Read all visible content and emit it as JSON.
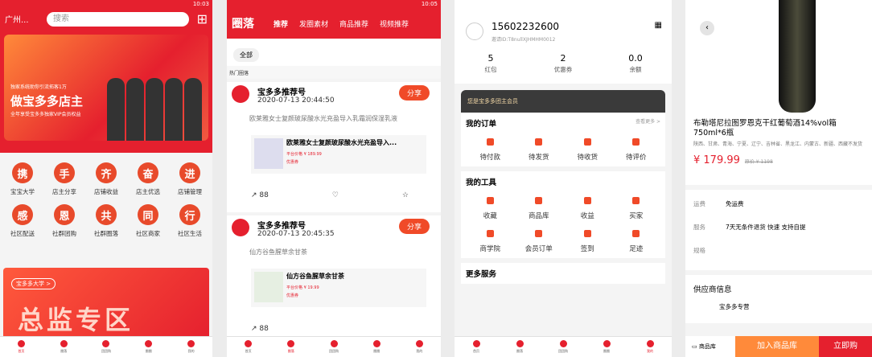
{
  "status_time": "10:03",
  "status_time2": "10:05",
  "home": {
    "location": "广州...",
    "search_placeholder": "搜索",
    "banner": {
      "line1": "独家系统助你引流拓客1万",
      "title": "做宝多多店主",
      "line3": "全年享受宝多多独家VIP会员权益"
    },
    "icons": [
      {
        "glyph": "携",
        "label": "宝宝大学"
      },
      {
        "glyph": "手",
        "label": "店主分享"
      },
      {
        "glyph": "齐",
        "label": "店铺收益"
      },
      {
        "glyph": "奋",
        "label": "店主优选"
      },
      {
        "glyph": "进",
        "label": "店铺管理"
      },
      {
        "glyph": "感",
        "label": "社区配送"
      },
      {
        "glyph": "恩",
        "label": "社群团购"
      },
      {
        "glyph": "共",
        "label": "社群圈落"
      },
      {
        "glyph": "同",
        "label": "社区商家"
      },
      {
        "glyph": "行",
        "label": "社区生活"
      }
    ],
    "zone": {
      "tag": "宝多多大学 >",
      "big": "总监专区"
    }
  },
  "tabs": [
    "首页",
    "圈落",
    "团团购",
    "圈圈",
    "我的"
  ],
  "feed": {
    "logo": "圈落",
    "tabs": [
      "推荐",
      "发圈素材",
      "商品推荐",
      "视频推荐"
    ],
    "chip": "全部",
    "hot": "热门圈落",
    "posts": [
      {
        "name": "宝多多推荐号",
        "date": "2020-07-13 20:44:50",
        "share": "分享",
        "desc": "欧莱雅女士复颜玻尿酸水光充盈导入乳霜润保湿乳液",
        "goods": "欧莱雅女士复颜玻尿酸水光充盈导入...",
        "price": "平台价格 ¥ 189.99",
        "coupon": "优惠券",
        "count": "88"
      },
      {
        "name": "宝多多推荐号",
        "date": "2020-07-13 20:45:35",
        "share": "分享",
        "desc": "仙方谷鱼腥草余甘茶",
        "goods": "仙方谷鱼腥草余甘茶",
        "price": "平台价格 ¥ 19.99",
        "coupon": "优惠券",
        "count": "88"
      }
    ]
  },
  "mine": {
    "phone": "15602232600",
    "invite": "邀请ID:T8nullXJHMHM0012",
    "stats": [
      {
        "v": "5",
        "k": "红包"
      },
      {
        "v": "2",
        "k": "优惠券"
      },
      {
        "v": "0.0",
        "k": "余额"
      }
    ],
    "vip": "您是宝多多团主会员",
    "orders": {
      "title": "我的订单",
      "more": "查看更多 >",
      "items": [
        "待付款",
        "待发货",
        "待收货",
        "待评价"
      ]
    },
    "tools": {
      "title": "我的工具",
      "items": [
        "收藏",
        "商品库",
        "收益",
        "买家",
        "商学院",
        "会员订单",
        "签到",
        "足迹"
      ]
    },
    "more": "更多服务"
  },
  "product": {
    "name": "布勒塔尼拉图罗恩克干红葡萄酒14%vol箱750ml*6瓶",
    "area": "陕西、甘肃、青海、宁夏、辽宁、吉林省、黑龙江、内蒙古、新疆、西藏不发货",
    "price": "¥ 179.99",
    "orig": "原价 ¥ 1198",
    "spec": [
      {
        "k": "运费",
        "v": "免运费"
      },
      {
        "k": "服务",
        "v": "7天无条件退货 快速 支持自提"
      },
      {
        "k": "规格",
        "v": ""
      }
    ],
    "supplier_title": "供应商信息",
    "supplier": "宝多多专营",
    "store": "商品库",
    "cart": "加入商品库",
    "buy": "立即购"
  }
}
